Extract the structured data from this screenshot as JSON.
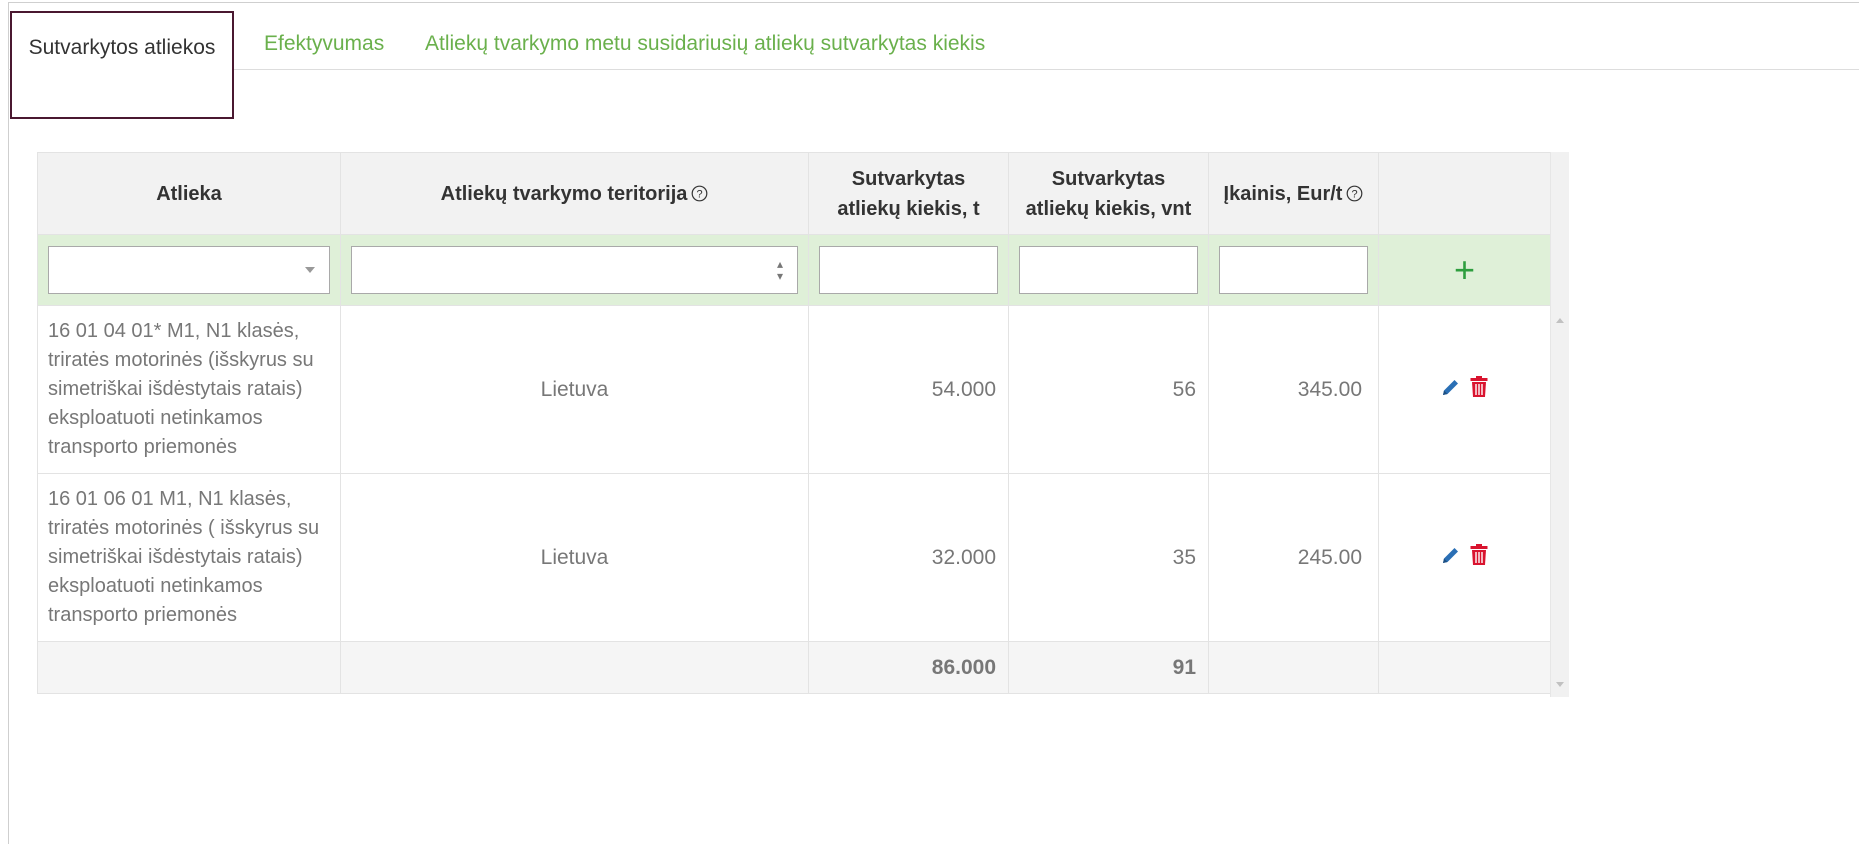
{
  "tabs": [
    {
      "label": "Sutvarkytos atliekos",
      "active": true
    },
    {
      "label": "Efektyvumas",
      "active": false
    },
    {
      "label": "Atliekų tvarkymo metu susidariusių atliekų sutvarkytas kiekis",
      "active": false
    }
  ],
  "table": {
    "headers": {
      "waste": "Atlieka",
      "territory": "Atliekų tvarkymo teritorija",
      "qty_t_line1": "Sutvarkytas",
      "qty_t_line2": "atliekų kiekis, t",
      "qty_vnt_line1": "Sutvarkytas",
      "qty_vnt_line2": "atliekų kiekis, vnt",
      "price": "Įkainis, Eur/t",
      "help_glyph": "?"
    },
    "filter": {
      "add_glyph": "+"
    },
    "rows": [
      {
        "waste": "16 01 04 01* M1, N1 klasės, triratės motorinės (išskyrus su simetriškai išdėstytais ratais) eksploatuoti netinkamos transporto priemonės",
        "territory": "Lietuva",
        "qty_t": "54.000",
        "qty_vnt": "56",
        "price": "345.00"
      },
      {
        "waste": "16 01 06 01 M1, N1 klasės, triratės motorinės ( išskyrus su simetriškai išdėstytais ratais) eksploatuoti netinkamos transporto priemonės",
        "territory": "Lietuva",
        "qty_t": "32.000",
        "qty_vnt": "35",
        "price": "245.00"
      }
    ],
    "totals": {
      "qty_t": "86.000",
      "qty_vnt": "91"
    }
  },
  "icons": {
    "edit": "pencil-icon",
    "delete": "trash-icon",
    "add": "plus-icon",
    "help": "help-circle-icon"
  },
  "colors": {
    "tab_link": "#6ab04c",
    "active_tab_border": "#4a1830",
    "filter_row_bg": "#dff0d8",
    "add_icon": "#2e9e3e",
    "edit_icon": "#2a6fb5",
    "delete_icon": "#d9142f"
  }
}
